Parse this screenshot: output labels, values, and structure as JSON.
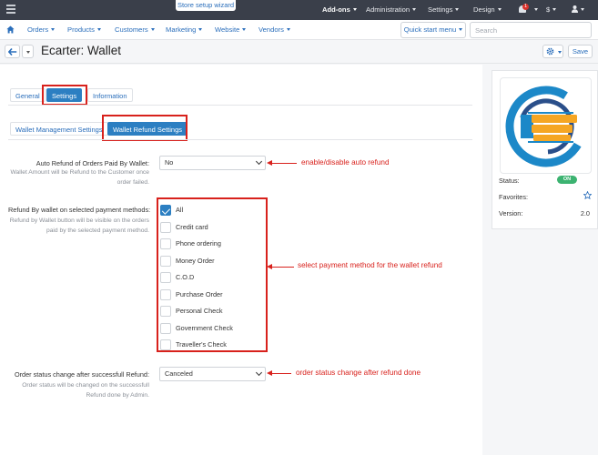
{
  "topbar": {
    "wizard": "Store setup wizard",
    "addons": "Add-ons",
    "administration": "Administration",
    "settings": "Settings",
    "design": "Design",
    "notif_count": "1",
    "currency": "$"
  },
  "nav": {
    "items": [
      "Orders",
      "Products",
      "Customers",
      "Marketing",
      "Website",
      "Vendors"
    ],
    "quick_start": "Quick start menu",
    "search_placeholder": "Search"
  },
  "header": {
    "title": "Ecarter: Wallet",
    "save": "Save"
  },
  "tabs": {
    "top": [
      "General",
      "Settings",
      "Information"
    ],
    "sub": [
      "Wallet Management Settings",
      "Wallet Refund Settings"
    ]
  },
  "form": {
    "auto_refund": {
      "label": "Auto Refund of Orders Paid By Wallet:",
      "help": "Wallet Amount will be Refund to the Customer once order failed.",
      "value": "No"
    },
    "refund_by_wallet": {
      "label": "Refund By wallet on selected payment methods:",
      "help": "Refund by Wallet button will be visible on the orders paid by the selected payment method.",
      "options": [
        {
          "label": "All",
          "checked": true
        },
        {
          "label": "Credit card",
          "checked": false
        },
        {
          "label": "Phone ordering",
          "checked": false
        },
        {
          "label": "Money Order",
          "checked": false
        },
        {
          "label": "C.O.D",
          "checked": false
        },
        {
          "label": "Purchase Order",
          "checked": false
        },
        {
          "label": "Personal Check",
          "checked": false
        },
        {
          "label": "Government Check",
          "checked": false
        },
        {
          "label": "Traveller's Check",
          "checked": false
        }
      ]
    },
    "status_change": {
      "label": "Order status change after successfull Refund:",
      "help": "Order status will be changed on the successfull Refund done by Admin.",
      "value": "Canceled"
    }
  },
  "annotations": {
    "auto_refund": "enable/disable auto refund",
    "payment": "select payment method for the wallet refund",
    "status": "order status change after refund done",
    "color": "#d8211c"
  },
  "sidebar": {
    "status_label": "Status:",
    "status_value": "ON",
    "favorites_label": "Favorites:",
    "version_label": "Version:",
    "version_value": "2.0"
  },
  "colors": {
    "accent": "#2c7fc2",
    "topbar": "#3a3f4a",
    "toggle_on": "#3cb371"
  }
}
